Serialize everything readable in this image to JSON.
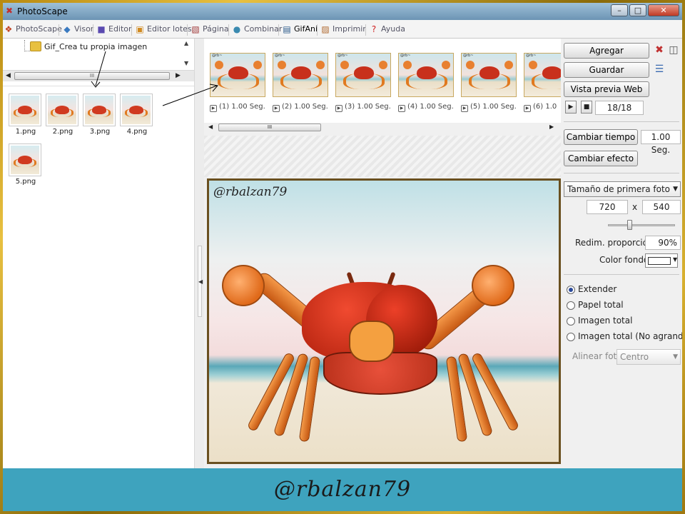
{
  "window": {
    "title": "PhotoScape",
    "minimize_glyph": "–",
    "maximize_glyph": "□",
    "close_glyph": "✕"
  },
  "tabs": [
    {
      "label": "PhotoScape",
      "icon": "photoscape-icon",
      "glyph": "❖",
      "color": "#c04020"
    },
    {
      "label": "Visor",
      "icon": "viewer-icon",
      "glyph": "◆",
      "color": "#3a7ac0"
    },
    {
      "label": "Editor",
      "icon": "editor-icon",
      "glyph": "■",
      "color": "#5a4ab0"
    },
    {
      "label": "Editor lotes",
      "icon": "batch-editor-icon",
      "glyph": "▣",
      "color": "#d08a20"
    },
    {
      "label": "Página",
      "icon": "page-icon",
      "glyph": "▧",
      "color": "#a03a3a"
    },
    {
      "label": "Combinar",
      "icon": "combine-icon",
      "glyph": "●",
      "color": "#3a8ab0"
    },
    {
      "label": "GifAni",
      "icon": "gifani-icon",
      "glyph": "▤",
      "color": "#2a5a8a"
    },
    {
      "label": "Imprimir",
      "icon": "print-icon",
      "glyph": "▨",
      "color": "#b06a30"
    },
    {
      "label": "Ayuda",
      "icon": "help-icon",
      "glyph": "?",
      "color": "#d02020"
    }
  ],
  "active_tab": "GifAni",
  "left_panel": {
    "folder_label": "Gif_Crea tu propia imagen",
    "scroll_thumb": "III",
    "files": [
      {
        "name": "1.png"
      },
      {
        "name": "2.png"
      },
      {
        "name": "3.png"
      },
      {
        "name": "4.png"
      },
      {
        "name": "5.png"
      }
    ]
  },
  "frames": [
    {
      "label": "(1) 1.00 Seg."
    },
    {
      "label": "(2) 1.00 Seg."
    },
    {
      "label": "(3) 1.00 Seg."
    },
    {
      "label": "(4) 1.00 Seg."
    },
    {
      "label": "(5) 1.00 Seg."
    },
    {
      "label": "(6) 1.0"
    }
  ],
  "frame_watermark": "@rb~",
  "strip_scroll_thumb": "III",
  "preview": {
    "watermark": "@rbalzan79"
  },
  "right_panel": {
    "add_button": "Agregar",
    "save_button": "Guardar",
    "web_preview_button": "Vista previa Web",
    "frame_counter": "18/18",
    "change_time_button": "Cambiar tiempo",
    "time_value": "1.00 Seg.",
    "change_effect_button": "Cambiar efecto",
    "size_select": "Tamaño de primera foto",
    "width_value": "720",
    "times_label": "x",
    "height_value": "540",
    "resize_label": "Redim. proporción",
    "resize_value": "90%",
    "bg_color_label": "Color fondo",
    "bg_color": "#ffffff",
    "radio_options": [
      {
        "label": "Extender",
        "selected": true
      },
      {
        "label": "Papel total",
        "selected": false
      },
      {
        "label": "Imagen total",
        "selected": false
      },
      {
        "label": "Imagen total (No agrandada)",
        "selected": false
      }
    ],
    "align_label": "Alinear foto",
    "align_value": "Centro"
  },
  "banner_text": "@rbalzan79",
  "colors": {
    "banner": "#3ea3be",
    "frame_gold": "#c89a20",
    "title_bar": "#7ca0c0"
  }
}
